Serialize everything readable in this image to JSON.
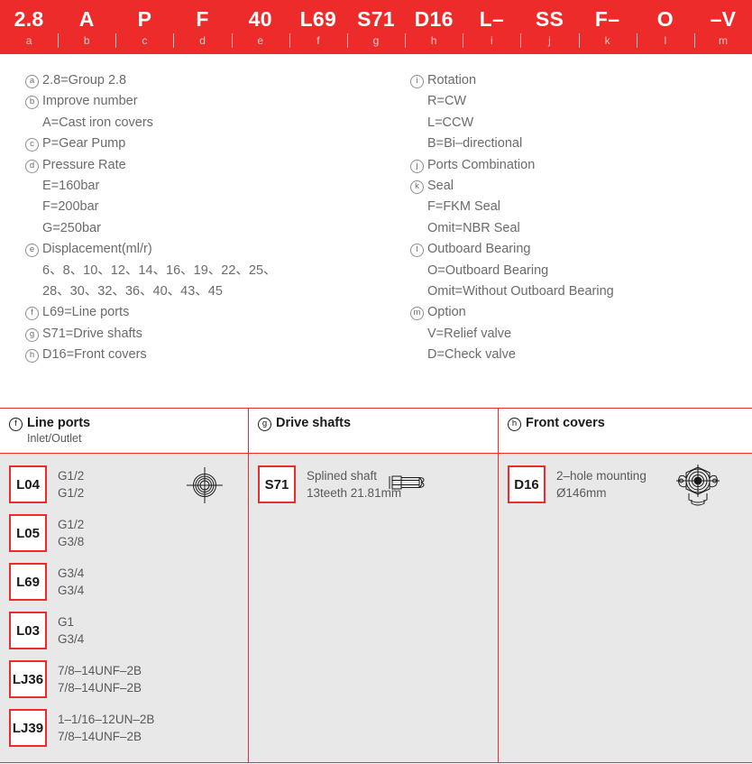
{
  "colors": {
    "brand_red": "#ee2b2b",
    "band_text": "#ffffff",
    "body_text": "#58595b",
    "table_body_bg": "#e8e8e8"
  },
  "code_band": {
    "codes": [
      "2.8",
      "A",
      "P",
      "F",
      "40",
      "L69",
      "S71",
      "D16",
      "L–",
      "SS",
      "F–",
      "O",
      "–V"
    ],
    "letters": [
      "a",
      "b",
      "c",
      "d",
      "e",
      "f",
      "g",
      "h",
      "i",
      "j",
      "k",
      "l",
      "m"
    ]
  },
  "legend": {
    "left": [
      {
        "marker": "a",
        "text": "2.8=Group 2.8",
        "sub": false
      },
      {
        "marker": "b",
        "text": "Improve number",
        "sub": false
      },
      {
        "marker": "",
        "text": "A=Cast iron covers",
        "sub": true
      },
      {
        "marker": "c",
        "text": "P=Gear Pump",
        "sub": false
      },
      {
        "marker": "d",
        "text": "Pressure Rate",
        "sub": false
      },
      {
        "marker": "",
        "text": "E=160bar",
        "sub": true
      },
      {
        "marker": "",
        "text": "F=200bar",
        "sub": true
      },
      {
        "marker": "",
        "text": "G=250bar",
        "sub": true
      },
      {
        "marker": "e",
        "text": "Displacement(ml/r)",
        "sub": false
      },
      {
        "marker": "",
        "text": "6、8、10、12、14、16、19、22、25、",
        "sub": true
      },
      {
        "marker": "",
        "text": "28、30、32、36、40、43、45",
        "sub": true
      },
      {
        "marker": "f",
        "text": "L69=Line ports",
        "sub": false
      },
      {
        "marker": "g",
        "text": "S71=Drive shafts",
        "sub": false
      },
      {
        "marker": "h",
        "text": "D16=Front covers",
        "sub": false
      }
    ],
    "right": [
      {
        "marker": "i",
        "text": "Rotation",
        "sub": false
      },
      {
        "marker": "",
        "text": "R=CW",
        "sub": true
      },
      {
        "marker": "",
        "text": "L=CCW",
        "sub": true
      },
      {
        "marker": "",
        "text": "B=Bi–directional",
        "sub": true
      },
      {
        "marker": "j",
        "text": "Ports Combination",
        "sub": false
      },
      {
        "marker": "k",
        "text": "Seal",
        "sub": false
      },
      {
        "marker": "",
        "text": "F=FKM Seal",
        "sub": true
      },
      {
        "marker": "",
        "text": "Omit=NBR Seal",
        "sub": true
      },
      {
        "marker": "l",
        "text": "Outboard Bearing",
        "sub": false
      },
      {
        "marker": "",
        "text": "O=Outboard Bearing",
        "sub": true
      },
      {
        "marker": "",
        "text": "Omit=Without Outboard Bearing",
        "sub": true
      },
      {
        "marker": "m",
        "text": "Option",
        "sub": false
      },
      {
        "marker": "",
        "text": "V=Relief valve",
        "sub": true
      },
      {
        "marker": "",
        "text": "D=Check valve",
        "sub": true
      }
    ]
  },
  "table": {
    "columns": [
      {
        "marker": "f",
        "title": "Line ports",
        "subtitle": "Inlet/Outlet",
        "icon": "port-symbol-icon",
        "rows": [
          {
            "code": "L04",
            "line1": "G1/2",
            "line2": "G1/2",
            "has_icon": true
          },
          {
            "code": "L05",
            "line1": "G1/2",
            "line2": "G3/8",
            "has_icon": false
          },
          {
            "code": "L69",
            "line1": "G3/4",
            "line2": "G3/4",
            "has_icon": false
          },
          {
            "code": "L03",
            "line1": "G1",
            "line2": "G3/4",
            "has_icon": false
          },
          {
            "code": "LJ36",
            "line1": "7/8–14UNF–2B",
            "line2": "7/8–14UNF–2B",
            "has_icon": false
          },
          {
            "code": "LJ39",
            "line1": "1–1/16–12UN–2B",
            "line2": "7/8–14UNF–2B",
            "has_icon": false
          }
        ]
      },
      {
        "marker": "g",
        "title": "Drive shafts",
        "subtitle": "",
        "icon": "splined-shaft-icon",
        "rows": [
          {
            "code": "S71",
            "line1": "Splined shaft",
            "line2": "13teeth 21.81mm",
            "has_icon": true
          }
        ]
      },
      {
        "marker": "h",
        "title": "Front covers",
        "subtitle": "",
        "icon": "flange-cover-icon",
        "rows": [
          {
            "code": "D16",
            "line1": "2–hole mounting",
            "line2": "Ø146mm",
            "has_icon": true
          }
        ]
      }
    ]
  }
}
